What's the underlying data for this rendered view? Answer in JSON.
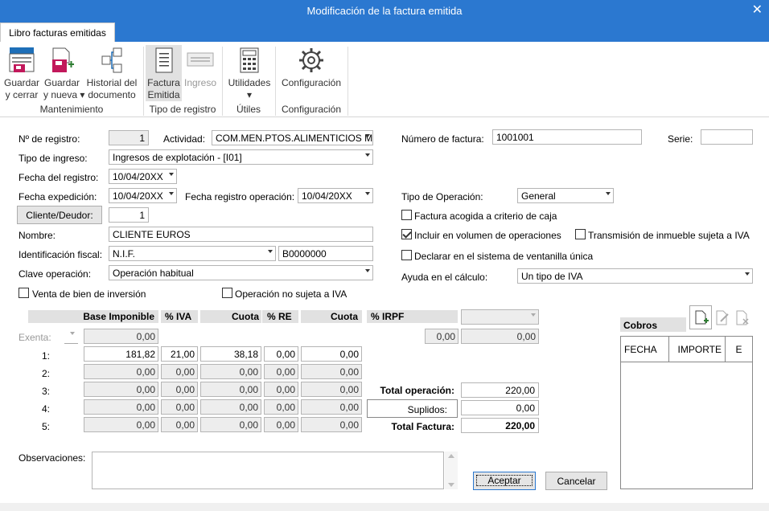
{
  "window": {
    "title": "Modificación de la factura emitida"
  },
  "tab": {
    "label": "Libro facturas emitidas"
  },
  "ribbon": {
    "save_close": "Guardar\ny cerrar",
    "save_new": "Guardar\ny nueva ▾",
    "history": "Historial del\ndocumento",
    "invoice_issued": "Factura\nEmitida",
    "income": "Ingreso",
    "utilities": "Utilidades\n▾",
    "configuration": "Configuración",
    "group_maintenance": "Mantenimiento",
    "group_register_type": "Tipo de registro",
    "group_utils": "Útiles",
    "group_config": "Configuración"
  },
  "form": {
    "registro_label": "Nº de registro:",
    "registro_value": "1",
    "actividad_label": "Actividad:",
    "actividad_value": "COM.MEN.PTOS.ALIMENTICIOS ME",
    "numero_factura_label": "Número de factura:",
    "numero_factura_value": "1001001",
    "serie_label": "Serie:",
    "serie_value": "",
    "tipo_ingreso_label": "Tipo de ingreso:",
    "tipo_ingreso_value": "Ingresos de explotación - [I01]",
    "fecha_registro_label": "Fecha del registro:",
    "fecha_registro_value": "10/04/20XX",
    "fecha_expedicion_label": "Fecha expedición:",
    "fecha_expedicion_value": "10/04/20XX",
    "fecha_reg_op_label": "Fecha registro operación:",
    "fecha_reg_op_value": "10/04/20XX",
    "tipo_operacion_label": "Tipo de Operación:",
    "tipo_operacion_value": "General",
    "cliente_button": "Cliente/Deudor:",
    "cliente_value": "1",
    "nombre_label": "Nombre:",
    "nombre_value": "CLIENTE EUROS",
    "ident_label": "Identificación fiscal:",
    "ident_type": "N.I.F.",
    "ident_value": "B0000000",
    "clave_label": "Clave operación:",
    "clave_value": "Operación habitual",
    "venta_bien": "Venta de bien de inversión",
    "op_no_sujeta": "Operación no sujeta a IVA",
    "criterio_caja": "Factura acogida a criterio de caja",
    "incluir_volumen": "Incluir en  volumen de operaciones",
    "transmision_inmueble": "Transmisión de inmueble sujeta a IVA",
    "ventanilla_unica": "Declarar en el sistema de ventanilla única",
    "ayuda_label": "Ayuda en el cálculo:",
    "ayuda_value": "Un tipo de IVA",
    "observaciones_label": "Observaciones:"
  },
  "table": {
    "headers": {
      "base": "Base Imponible",
      "iva": "% IVA",
      "cuota": "Cuota",
      "re": "% RE",
      "cuota_re": "Cuota",
      "irpf": "% IRPF"
    },
    "exenta_label": "Exenta:",
    "exenta_base": "0,00",
    "irpf_base": "0,00",
    "irpf_value": "0,00",
    "rows": [
      {
        "label": "1:",
        "base": "181,82",
        "iva": "21,00",
        "cuota": "38,18",
        "re": "0,00",
        "cuota_re": "0,00"
      },
      {
        "label": "2:",
        "base": "0,00",
        "iva": "0,00",
        "cuota": "0,00",
        "re": "0,00",
        "cuota_re": "0,00"
      },
      {
        "label": "3:",
        "base": "0,00",
        "iva": "0,00",
        "cuota": "0,00",
        "re": "0,00",
        "cuota_re": "0,00"
      },
      {
        "label": "4:",
        "base": "0,00",
        "iva": "0,00",
        "cuota": "0,00",
        "re": "0,00",
        "cuota_re": "0,00"
      },
      {
        "label": "5:",
        "base": "0,00",
        "iva": "0,00",
        "cuota": "0,00",
        "re": "0,00",
        "cuota_re": "0,00"
      }
    ],
    "total_operacion_label": "Total operación:",
    "total_operacion_value": "220,00",
    "suplidos_label": "Suplidos:",
    "suplidos_value": "0,00",
    "total_factura_label": "Total Factura:",
    "total_factura_value": "220,00"
  },
  "cobros": {
    "title": "Cobros",
    "col_fecha": "FECHA",
    "col_importe": "IMPORTE",
    "col_e": "E"
  },
  "buttons": {
    "aceptar": "Aceptar",
    "cancelar": "Cancelar"
  },
  "colors": {
    "titlebar": "#2b78d0",
    "icon_pink": "#c2185b",
    "icon_blue": "#1e6fb8",
    "icon_green": "#2e7d32"
  }
}
